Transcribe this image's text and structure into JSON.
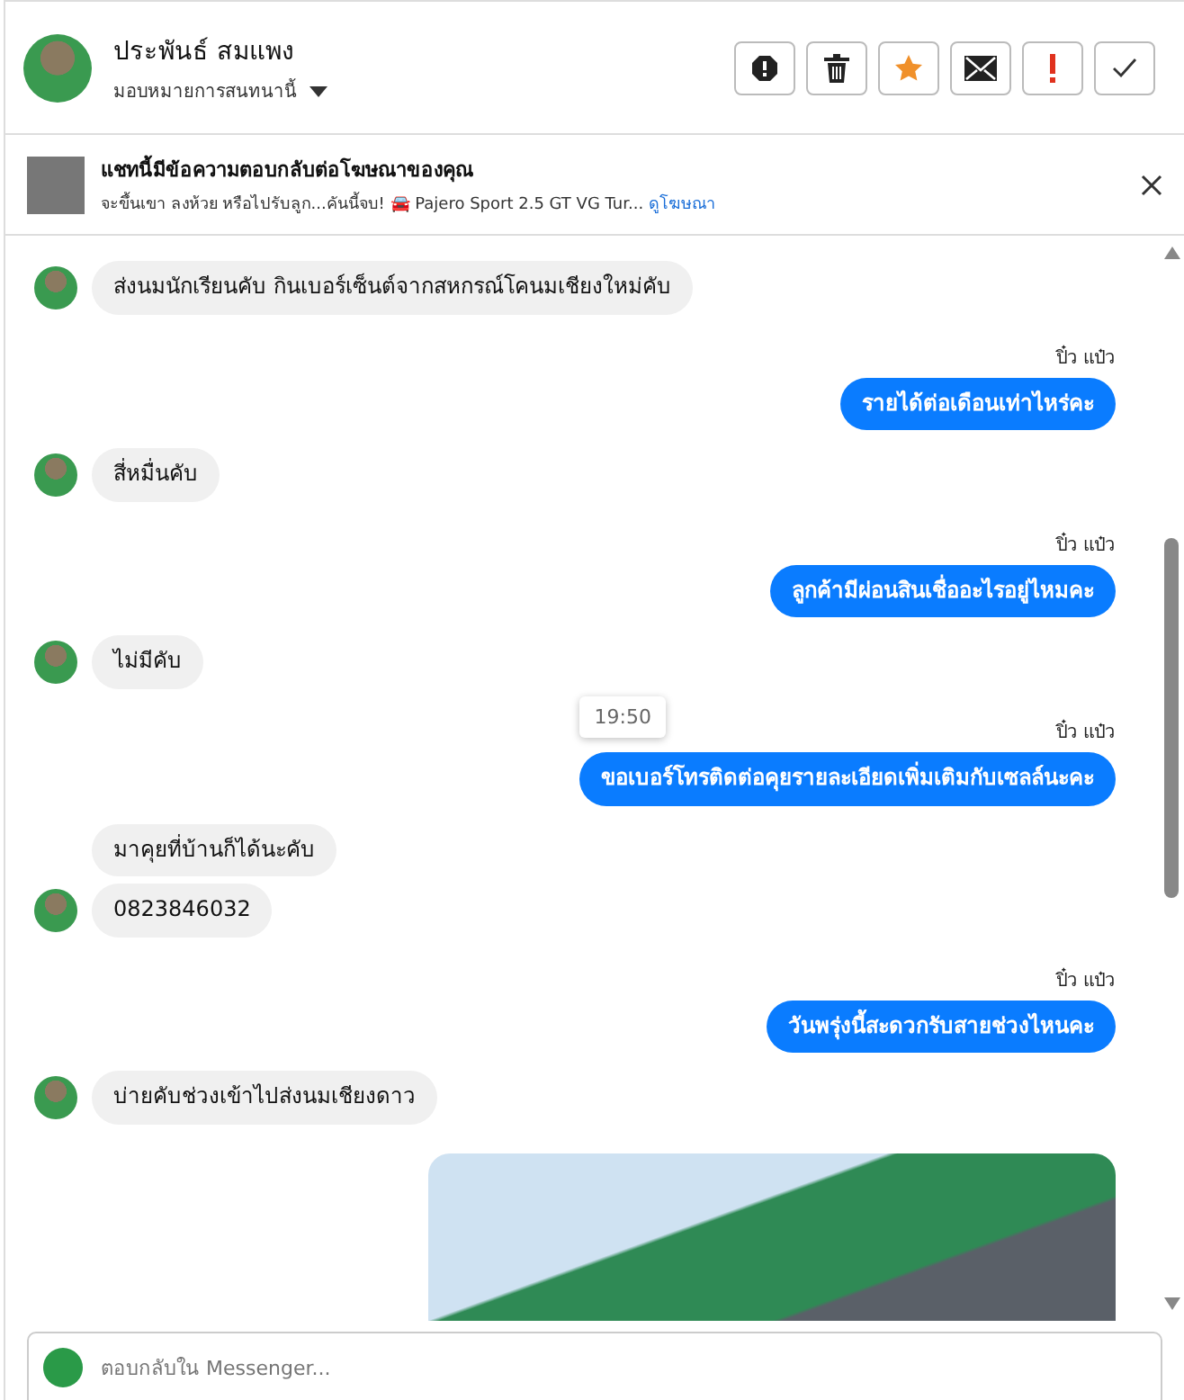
{
  "header": {
    "name": "ประพันธ์ สมแพง",
    "assign_label": "มอบหมายการสนทนานี้"
  },
  "ad_banner": {
    "title": "แชทนี้มีข้อความตอบกลับต่อโฆษณาของคุณ",
    "snippet": "จะขึ้นเขา ลงห้วย หรือไปรับลูก...คันนี้จบ! 🚘 Pajero Sport 2.5 GT VG Tur...",
    "link": "ดูโฆษณา"
  },
  "messages": [
    {
      "kind": "incoming",
      "texts": [
        "ส่งนมนักเรียนคับ กินเบอร์เซ็นต์จากสหกรณ์โคนมเชียงใหม่คับ"
      ]
    },
    {
      "kind": "outgoing",
      "sender": "ปิ๋ว แป๋ว",
      "texts": [
        "รายได้ต่อเดือนเท่าไหร่คะ"
      ]
    },
    {
      "kind": "incoming",
      "texts": [
        "สี่หมื่นคับ"
      ]
    },
    {
      "kind": "outgoing",
      "sender": "ปิ๋ว แป๋ว",
      "texts": [
        "ลูกค้ามีผ่อนสินเชื่ออะไรอยู่ไหมคะ"
      ]
    },
    {
      "kind": "incoming",
      "texts": [
        "ไม่มีคับ"
      ]
    },
    {
      "kind": "outgoing",
      "sender": "ปิ๋ว แป๋ว",
      "tooltip": "19:50",
      "texts": [
        "ขอเบอร์โทรติดต่อคุยรายละเอียดเพิ่มเติมกับเซลล์นะคะ"
      ]
    },
    {
      "kind": "incoming",
      "texts": [
        "มาคุยที่บ้านก็ได้นะคับ",
        "0823846032"
      ]
    },
    {
      "kind": "outgoing",
      "sender": "ปิ๋ว แป๋ว",
      "texts": [
        "วันพรุ่งนี้สะดวกรับสายช่วงไหนคะ"
      ]
    },
    {
      "kind": "incoming",
      "texts": [
        "บ่ายคับช่วงเข้าไปส่งนมเชียงดาว"
      ]
    },
    {
      "kind": "image"
    }
  ],
  "composer": {
    "placeholder": "ตอบกลับใน Messenger..."
  }
}
